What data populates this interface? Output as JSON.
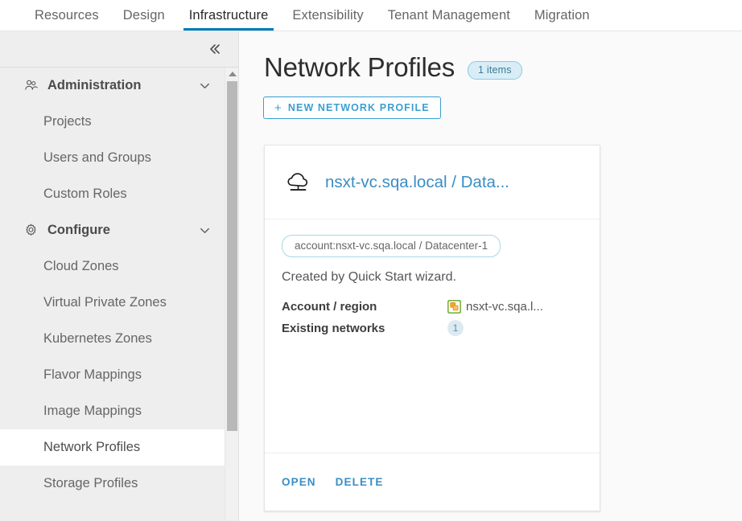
{
  "topnav": {
    "tabs": [
      {
        "label": "Resources",
        "active": false
      },
      {
        "label": "Design",
        "active": false
      },
      {
        "label": "Infrastructure",
        "active": true
      },
      {
        "label": "Extensibility",
        "active": false
      },
      {
        "label": "Tenant Management",
        "active": false
      },
      {
        "label": "Migration",
        "active": false
      }
    ],
    "active_tab_color": "#0079b8"
  },
  "sidebar": {
    "collapse_icon": "double-chevron-left-icon",
    "groups": [
      {
        "label": "Administration",
        "icon": "users-group-icon",
        "chevron": "chevron-down-icon",
        "items": [
          {
            "label": "Projects",
            "selected": false
          },
          {
            "label": "Users and Groups",
            "selected": false
          },
          {
            "label": "Custom Roles",
            "selected": false
          }
        ]
      },
      {
        "label": "Configure",
        "icon": "gear-icon",
        "chevron": "chevron-down-icon",
        "items": [
          {
            "label": "Cloud Zones",
            "selected": false
          },
          {
            "label": "Virtual Private Zones",
            "selected": false
          },
          {
            "label": "Kubernetes Zones",
            "selected": false
          },
          {
            "label": "Flavor Mappings",
            "selected": false
          },
          {
            "label": "Image Mappings",
            "selected": false
          },
          {
            "label": "Network Profiles",
            "selected": true
          },
          {
            "label": "Storage Profiles",
            "selected": false
          }
        ]
      }
    ],
    "scrollbar": {
      "up_arrow_icon": "scroll-up-arrow-icon"
    }
  },
  "main": {
    "page_title": "Network Profiles",
    "items_badge": "1 items",
    "new_button": {
      "plus": "+",
      "label": "NEW NETWORK PROFILE"
    },
    "card": {
      "icon": "cloud-network-icon",
      "title": "nsxt-vc.sqa.local / Data...",
      "tag": "account:nsxt-vc.sqa.local / Datacenter-1",
      "description": "Created by Quick Start wizard.",
      "details": [
        {
          "key": "Account / region",
          "value": "nsxt-vc.sqa.l...",
          "icon": "vsphere-icon",
          "badge": null
        },
        {
          "key": "Existing networks",
          "value": null,
          "icon": null,
          "badge": "1"
        }
      ],
      "actions": [
        {
          "label": "OPEN"
        },
        {
          "label": "DELETE"
        }
      ]
    }
  },
  "colors": {
    "accent": "#3a8dc4",
    "active_tab_underline": "#0079b8",
    "badge_bg": "#d9edf7",
    "sidebar_bg": "#eeeeee"
  }
}
